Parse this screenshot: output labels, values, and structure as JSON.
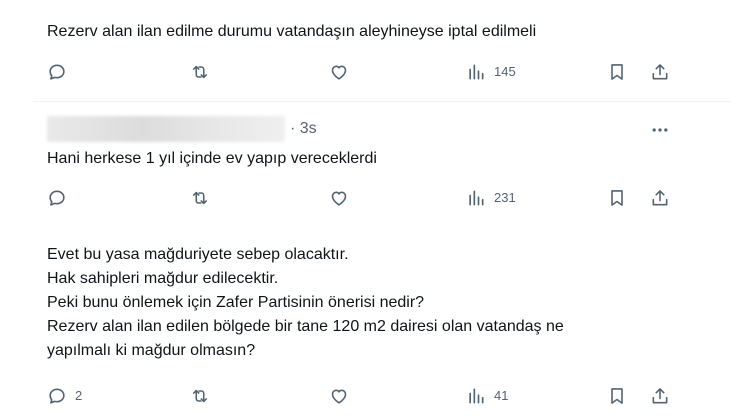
{
  "tweets": [
    {
      "text": "Rezerv alan ilan edilme durumu vatandaşın aleyhineyse iptal edilmeli",
      "views": "145"
    },
    {
      "time": "· 3s",
      "text": "Hani herkese 1 yıl içinde ev yapıp vereceklerdi",
      "views": "231"
    },
    {
      "lines": [
        "Evet bu yasa mağduriyete sebep olacaktır.",
        "Hak sahipleri mağdur edilecektir.",
        "Peki bunu önlemek için Zafer Partisinin önerisi nedir?",
        "Rezerv alan ilan edilen bölgede bir tane 120 m2 dairesi olan vatandaş ne",
        "yapılmalı ki mağdur olmasın?"
      ],
      "replies": "2",
      "views": "41"
    }
  ],
  "icons": {
    "reply": "reply-icon",
    "retweet": "retweet-icon",
    "like": "like-icon",
    "views": "views-icon",
    "bookmark": "bookmark-icon",
    "share": "share-icon",
    "more": "more-icon"
  },
  "colors": {
    "text": "#0f1419",
    "secondary": "#536471",
    "divider": "#eff3f4"
  }
}
